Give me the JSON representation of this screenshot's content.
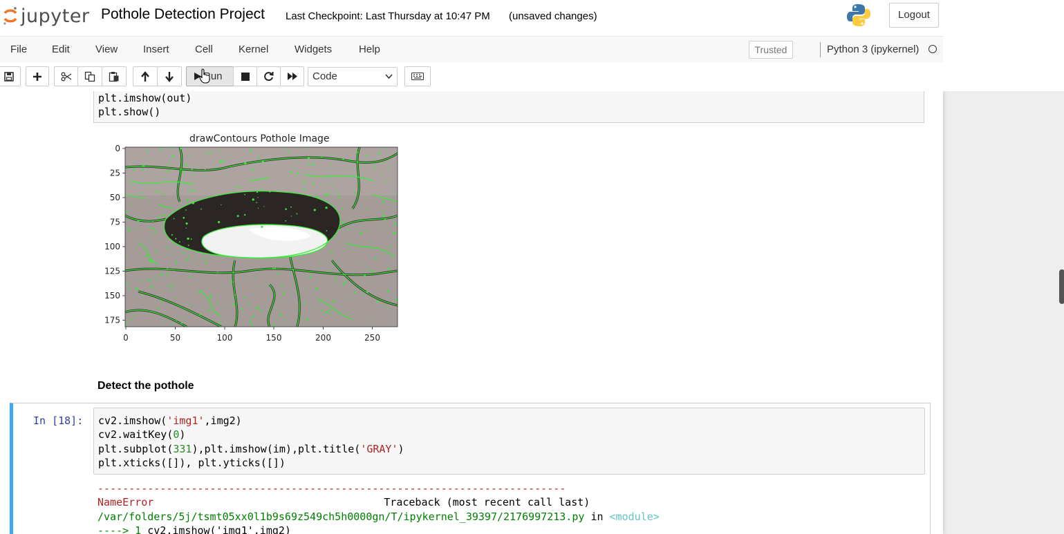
{
  "header": {
    "logo_text": "jupyter",
    "notebook_name": "Pothole Detection Project",
    "checkpoint": "Last Checkpoint: Last Thursday at 10:47 PM",
    "autosave_status": "(unsaved changes)",
    "logout_label": "Logout"
  },
  "menubar": {
    "items": [
      "File",
      "Edit",
      "View",
      "Insert",
      "Cell",
      "Kernel",
      "Widgets",
      "Help"
    ],
    "trusted_label": "Trusted",
    "kernel_name": "Python 3 (ipykernel)"
  },
  "toolbar": {
    "run_label": "Run",
    "cell_type": "Code",
    "buttons": [
      "save-icon",
      "plus-icon",
      "scissors-icon",
      "copy-icon",
      "paste-icon",
      "arrow-up-icon",
      "arrow-down-icon",
      "play-icon",
      "stop-icon",
      "restart-icon",
      "fast-forward-icon",
      "keyboard-icon"
    ]
  },
  "cell1": {
    "code_lines": [
      "plt.imshow(out)",
      "plt.show()"
    ]
  },
  "plot": {
    "title": "drawContours Pothole Image",
    "yticks": [
      "0",
      "25",
      "50",
      "75",
      "100",
      "125",
      "150",
      "175"
    ],
    "xticks": [
      "0",
      "50",
      "100",
      "150",
      "200",
      "250"
    ]
  },
  "markdown": {
    "heading": "Detect the pothole"
  },
  "cell2": {
    "prompt": "In [18]:",
    "line1": {
      "a": "cv2.imshow(",
      "s": "'img1'",
      "b": ",img2)"
    },
    "line2": {
      "a": "cv2.waitKey(",
      "n": "0",
      "b": ")"
    },
    "line3": {
      "a": "plt.subplot(",
      "n": "331",
      "b": "),plt.imshow(im),plt.title(",
      "s": "'GRAY'",
      "c": ")"
    },
    "line4": "plt.xticks([]), plt.yticks([])"
  },
  "error": {
    "dashes": "---------------------------------------------------------------------------",
    "name": "NameError",
    "traceback": "Traceback (most recent call last)",
    "path": "/var/folders/5j/tsmt05xx0l1b9s69z549ch5h0000gn/T/ipykernel_39397/2176997213.py",
    "in_word": "in",
    "module": "<module>",
    "arrow": "----> 1",
    "code": "cv2.imshow('img1',img2)"
  },
  "colors": {
    "accent": "#42a5f5",
    "prompt": "#303f9f",
    "error_red": "#b22222",
    "error_green": "#008000",
    "error_cyan": "#60c6c8",
    "contour": "#3ee83e"
  }
}
